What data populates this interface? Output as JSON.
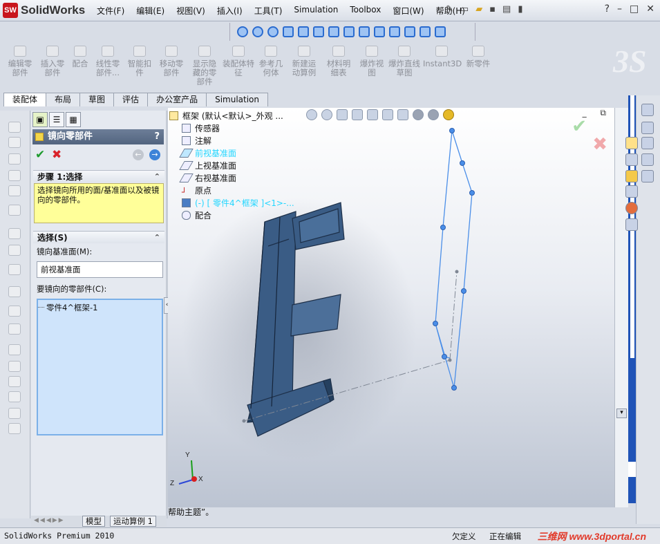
{
  "app": {
    "logo_badge": "SW",
    "logo_name": "SolidWorks",
    "menu": [
      "文件(F)",
      "编辑(E)",
      "视图(V)",
      "插入(I)",
      "工具(T)",
      "Simulation",
      "Toolbox",
      "窗口(W)",
      "帮助(H)"
    ],
    "window_controls": {
      "help": "?",
      "minimize": "–",
      "restore": "□",
      "close": "✕"
    }
  },
  "command_manager": [
    "编辑零部件",
    "插入零部件",
    "配合",
    "线性零部件...",
    "智能扣件",
    "移动零部件",
    "显示隐藏的零部件",
    "装配体特征",
    "参考几何体",
    "新建运动算例",
    "材料明细表",
    "爆炸视图",
    "爆炸直线草图",
    "Instant3D",
    "新零件"
  ],
  "tabs": [
    "装配体",
    "布局",
    "草图",
    "评估",
    "办公室产品",
    "Simulation"
  ],
  "active_tab": "装配体",
  "property_manager": {
    "title": "镜向零部件",
    "help": "?",
    "ok_symbol": "✔",
    "cancel_symbol": "✖",
    "back_symbol": "←",
    "forward_symbol": "→",
    "step_title": "步骤 1:选择",
    "step_message": "选择镜向所用的面/基准面以及被镜向的零部件。",
    "selection_title": "选择(S)",
    "collapse_symbol": "⌃",
    "mirror_plane_label": "镜向基准面(M):",
    "mirror_plane_value": "前视基准面",
    "components_label": "要镜向的零部件(C):",
    "components": [
      "零件4^框架-1"
    ]
  },
  "feature_tree": {
    "root": "框架  (默认<默认>_外观 ...",
    "items": [
      {
        "label": "传感器",
        "icon": "sensor-icon"
      },
      {
        "label": "注解",
        "icon": "annotation-icon"
      },
      {
        "label": "前视基准面",
        "icon": "plane-icon",
        "selected": true
      },
      {
        "label": "上视基准面",
        "icon": "plane-icon"
      },
      {
        "label": "右视基准面",
        "icon": "plane-icon"
      },
      {
        "label": "原点",
        "icon": "origin-icon"
      },
      {
        "label": "(-) [ 零件4^框架 ]<1>-...",
        "icon": "part-icon",
        "selected": true
      },
      {
        "label": "配合",
        "icon": "mates-icon"
      }
    ]
  },
  "graphics": {
    "ok_symbol": "✔",
    "cancel_symbol": "✖",
    "window_controls": "_ ⧉",
    "breadcrumb": "帮助主题”。",
    "triad": {
      "x": "X",
      "y": "Y",
      "z": "Z"
    }
  },
  "bottom_tabs": [
    "模型",
    "运动算例 1"
  ],
  "status": {
    "app": "SolidWorks Premium 2010",
    "definition": "欠定义",
    "editing": "正在编辑",
    "watermark": "三维网 www.3dportal.cn"
  },
  "colors": {
    "part": "#3a5c85",
    "preview": "#4a8ee8",
    "menubar": "#e3e7ee",
    "selection": "#23d6ff",
    "pm_header": "#5d6f8b",
    "message_bg": "#ffff99"
  }
}
